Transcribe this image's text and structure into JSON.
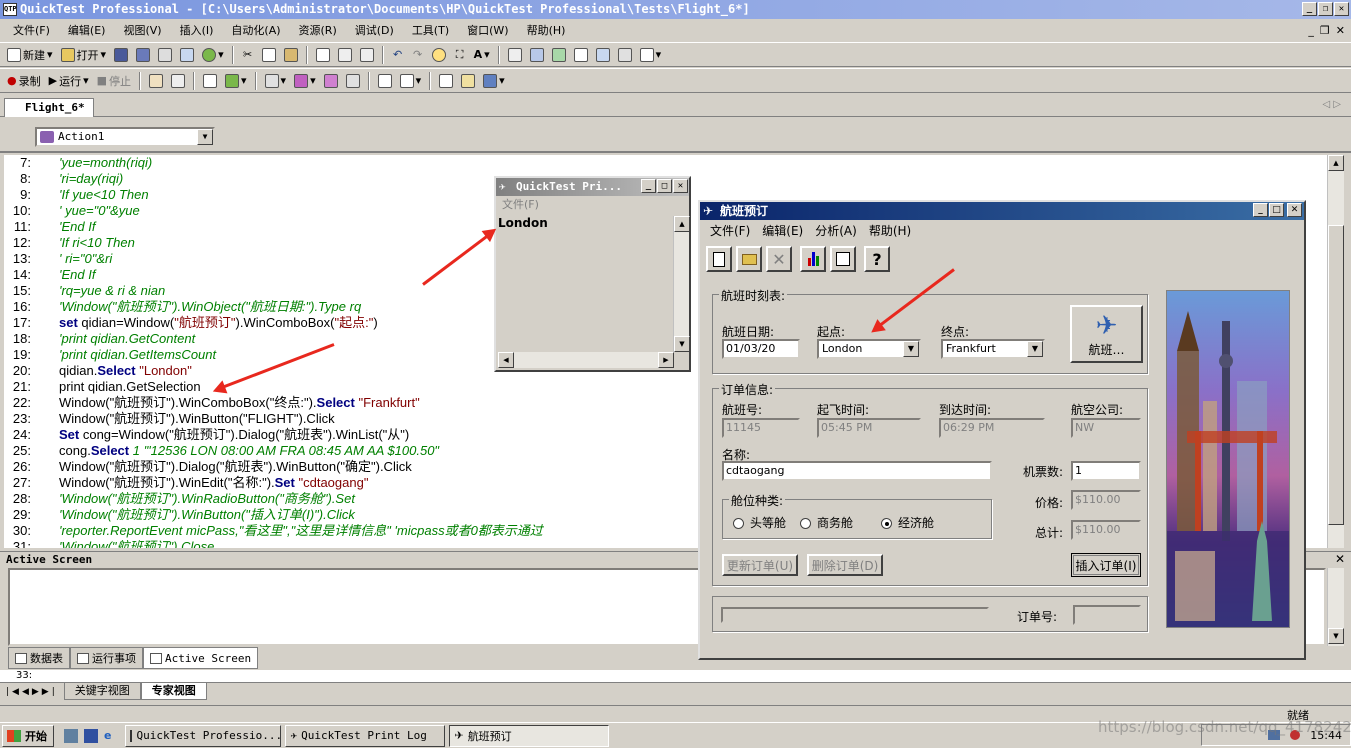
{
  "window": {
    "title": "QuickTest Professional - [C:\\Users\\Administrator\\Documents\\HP\\QuickTest Professional\\Tests\\Flight_6*]",
    "icon_text": "QTP"
  },
  "menu": [
    "文件(F)",
    "编辑(E)",
    "视图(V)",
    "插入(I)",
    "自动化(A)",
    "资源(R)",
    "调试(D)",
    "工具(T)",
    "窗口(W)",
    "帮助(H)"
  ],
  "toolbar1": {
    "new": "新建",
    "open": "打开"
  },
  "toolbar2": {
    "record": "录制",
    "run": "运行",
    "stop": "停止"
  },
  "doc_tab": "Flight_6*",
  "action_combo": "Action1",
  "code_lines": [
    {
      "n": "7:",
      "t": "'yue=month(riqi)",
      "c": "cmt"
    },
    {
      "n": "8:",
      "t": "'ri=day(riqi)",
      "c": "cmt"
    },
    {
      "n": "9:",
      "t": "'If yue<10 Then",
      "c": "cmt"
    },
    {
      "n": "10:",
      "t": "'   yue=\"0\"&yue",
      "c": "cmt"
    },
    {
      "n": "11:",
      "t": "'End If",
      "c": "cmt"
    },
    {
      "n": "12:",
      "t": "'If ri<10 Then",
      "c": "cmt"
    },
    {
      "n": "13:",
      "t": "'   ri=\"0\"&ri",
      "c": "cmt"
    },
    {
      "n": "14:",
      "t": "'End If",
      "c": "cmt"
    },
    {
      "n": "15:",
      "t": "'rq=yue & ri & nian",
      "c": "cmt"
    },
    {
      "n": "16:",
      "t": "'Window(\"航班预订\").WinObject(\"航班日期:\").Type rq",
      "c": "cmt"
    },
    {
      "n": "17:",
      "t": "",
      "c": "mix17"
    },
    {
      "n": "18:",
      "t": "'print qidian.GetContent",
      "c": "cmt"
    },
    {
      "n": "19:",
      "t": "'print qidian.GetItemsCount",
      "c": "cmt"
    },
    {
      "n": "20:",
      "t": "",
      "c": "mix20"
    },
    {
      "n": "21:",
      "t": "print qidian.GetSelection",
      "c": "plain"
    },
    {
      "n": "22:",
      "t": "",
      "c": "mix22"
    },
    {
      "n": "23:",
      "t": "Window(\"航班预订\").WinButton(\"FLIGHT\").Click",
      "c": "plain"
    },
    {
      "n": "24:",
      "t": "",
      "c": "mix24"
    },
    {
      "n": "25:",
      "t": "",
      "c": "mix25"
    },
    {
      "n": "26:",
      "t": "Window(\"航班预订\").Dialog(\"航班表\").WinButton(\"确定\").Click",
      "c": "plain"
    },
    {
      "n": "27:",
      "t": "",
      "c": "mix27"
    },
    {
      "n": "28:",
      "t": "'Window(\"航班预订\").WinRadioButton(\"商务舱\").Set",
      "c": "cmt"
    },
    {
      "n": "29:",
      "t": "'Window(\"航班预订\").WinButton(\"插入订单(I)\").Click",
      "c": "cmt"
    },
    {
      "n": "30:",
      "t": "'reporter.ReportEvent micPass,\"看这里\",\"这里是详情信息\"           'micpass或者0都表示通过",
      "c": "cmt"
    },
    {
      "n": "31:",
      "t": "'Window(\"航班预订\").Close",
      "c": "cmt"
    }
  ],
  "mix": {
    "l17a": "set",
    "l17b": " qidian=Window(",
    "l17c": "\"航班预订\"",
    "l17d": ").WinComboBox(",
    "l17e": "\"起点:\"",
    "l17f": ")",
    "l20a": "qidian.",
    "l20b": "Select",
    "l20c": " \"London\"",
    "l22a": "Window(\"航班预订\").WinComboBox(\"终点:\").",
    "l22b": "Select",
    "l22c": " \"Frankfurt\"",
    "l24a": "Set",
    "l24b": " cong=Window(\"航班预订\").Dialog(\"航班表\").WinList(\"从\")",
    "l25a": "cong.",
    "l25b": "Select",
    "l25c": " 1   '\"12536   LON   08:00 AM   FRA   08:45 AM   AA    $100.50\"",
    "l27a": "Window(\"航班预订\").WinEdit(\"名称:\").",
    "l27b": "Set",
    "l27c": " \"cdtaogang\""
  },
  "active_screen": {
    "title": "Active Screen"
  },
  "bottom_tabs": [
    "数据表",
    "运行事项",
    "Active Screen"
  ],
  "view_tabs": [
    "关键字视图",
    "专家视图"
  ],
  "line_hint": "33:",
  "status": {
    "ready": "就绪"
  },
  "print_log": {
    "title": "QuickTest Pri...",
    "menu": "文件(F)",
    "text": "London"
  },
  "flight": {
    "title": "航班预订",
    "menu": [
      "文件(F)",
      "编辑(E)",
      "分析(A)",
      "帮助(H)"
    ],
    "schedule_group": "航班时刻表:",
    "date_label": "航班日期:",
    "date_value": "01/03/20",
    "from_label": "起点:",
    "from_value": "London",
    "to_label": "终点:",
    "to_value": "Frankfurt",
    "flight_btn": "航班…",
    "order_group": "订单信息:",
    "flightno_label": "航班号:",
    "flightno_value": "11145",
    "depart_label": "起飞时间:",
    "depart_value": "05:45 PM",
    "arrive_label": "到达时间:",
    "arrive_value": "06:29 PM",
    "airline_label": "航空公司:",
    "airline_value": "NW",
    "name_label": "名称:",
    "name_value": "cdtaogang",
    "tickets_label": "机票数:",
    "tickets_value": "1",
    "class_group": "舱位种类:",
    "class_first": "头等舱",
    "class_business": "商务舱",
    "class_economy": "经济舱",
    "price_label": "价格:",
    "price_value": "$110.00",
    "total_label": "总计:",
    "total_value": "$110.00",
    "update_btn": "更新订单(U)",
    "delete_btn": "删除订单(D)",
    "insert_btn": "插入订单(I)",
    "orderno_label": "订单号:"
  },
  "taskbar": {
    "start": "开始",
    "items": [
      "QuickTest Professio...",
      "QuickTest Print Log",
      "航班预订"
    ],
    "clock": "15:44"
  },
  "watermark": "https://blog.csdn.net/qq_41782425"
}
